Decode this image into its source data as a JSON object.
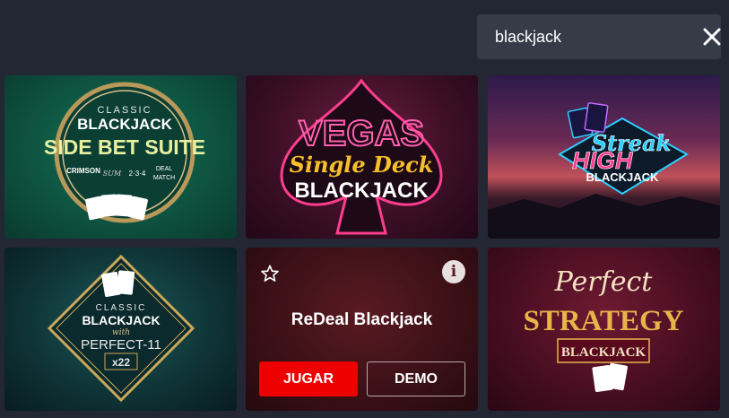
{
  "search": {
    "value": "blackjack",
    "clear_icon": "close-icon"
  },
  "games": [
    {
      "lines": [
        "CLASSIC",
        "BLACKJACK",
        "SIDE BET SUITE",
        "CRIMSON",
        "SUM",
        "2·3·4",
        "DEAL",
        "MATCH"
      ]
    },
    {
      "lines": [
        "VEGAS",
        "Single Deck",
        "BLACKJACK"
      ]
    },
    {
      "lines": [
        "HIGH",
        "Streak",
        "BLACKJACK"
      ]
    },
    {
      "lines": [
        "CLASSIC",
        "BLACKJACK",
        "with",
        "PERFECT-11",
        "x22"
      ]
    },
    {
      "title": "ReDeal Blackjack",
      "play_label": "JUGAR",
      "demo_label": "DEMO",
      "info_label": "i",
      "favorite_icon": "star-icon"
    },
    {
      "lines": [
        "Perfect",
        "STRATEGY",
        "BLACKJACK"
      ]
    }
  ],
  "colors": {
    "background": "#232733",
    "search_bg": "#363b47",
    "play_button": "#ee0000"
  }
}
